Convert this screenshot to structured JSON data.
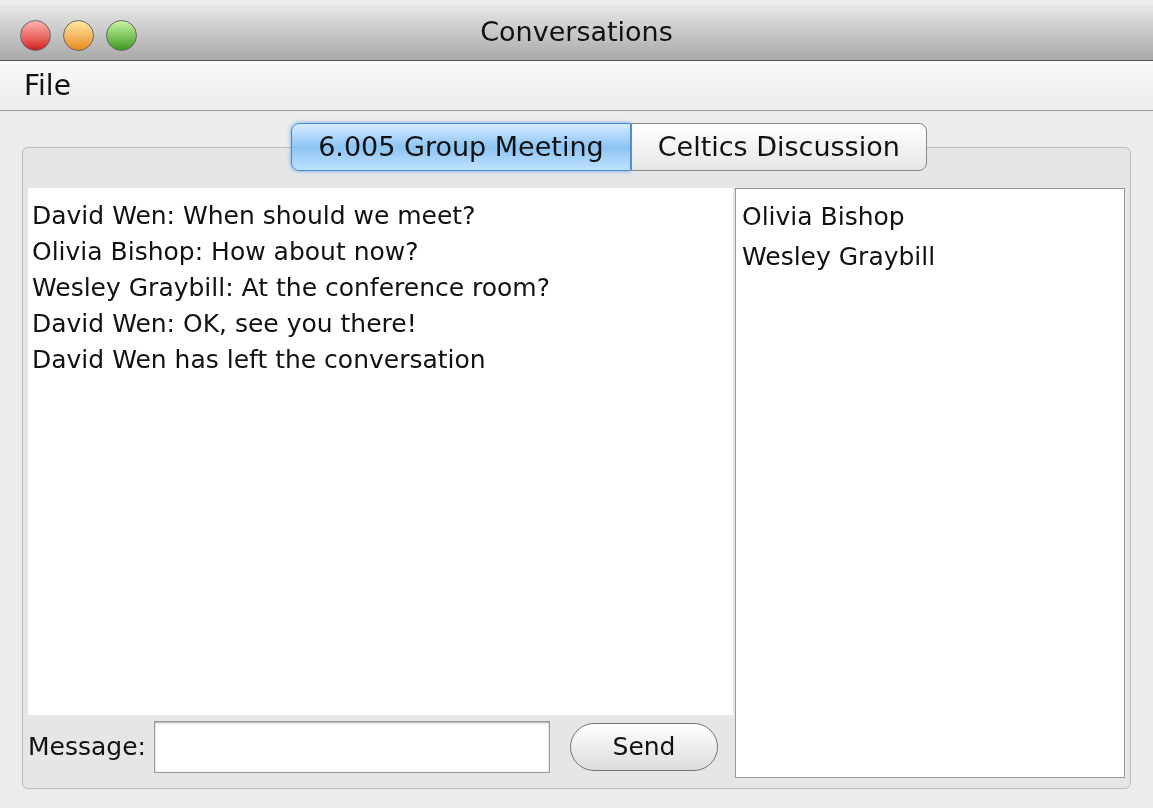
{
  "window": {
    "title": "Conversations"
  },
  "menu": [
    "File"
  ],
  "tabs": [
    {
      "label": "6.005 Group Meeting",
      "selected": true
    },
    {
      "label": "Celtics Discussion",
      "selected": false
    }
  ],
  "messages": [
    "David Wen: When should we meet?",
    "Olivia Bishop: How about now?",
    "Wesley Graybill: At the conference room?",
    "David Wen: OK, see you there!",
    "David Wen has left the conversation"
  ],
  "message_field": {
    "label": "Message:"
  },
  "send_button": "Send",
  "users": [
    "Olivia Bishop",
    "Wesley Graybill"
  ]
}
